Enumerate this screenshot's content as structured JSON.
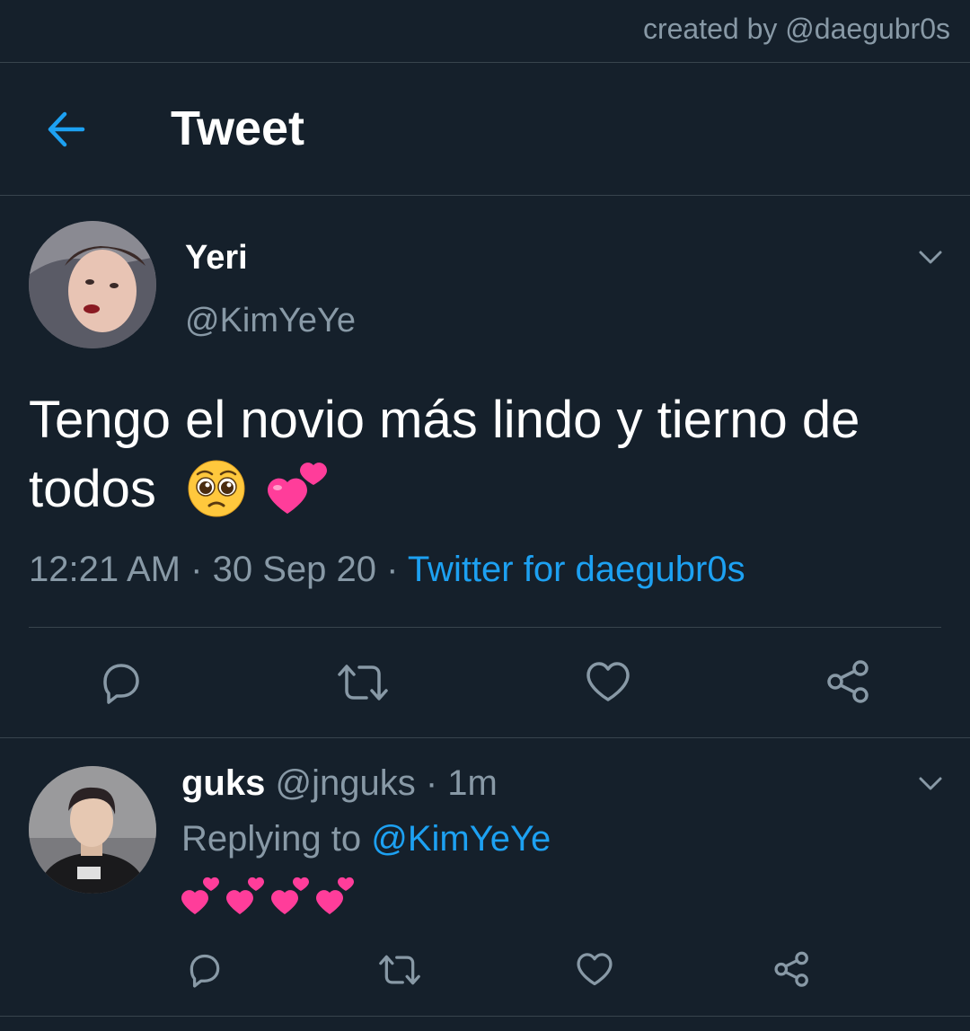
{
  "watermark": "created by @daegubr0s",
  "header": {
    "title": "Tweet",
    "back_icon": "arrow-left-icon"
  },
  "tweet": {
    "display_name": "Yeri",
    "handle": "@KimYeYe",
    "text": "Tengo el novio más lindo y tierno de todos",
    "emojis": [
      "pleading-face",
      "two-hearts"
    ],
    "time": "12:21 AM",
    "date": "30 Sep 20",
    "separator": "·",
    "source": "Twitter for daegubr0s",
    "actions": [
      "reply-icon",
      "retweet-icon",
      "like-icon",
      "share-icon"
    ]
  },
  "reply": {
    "display_name": "guks",
    "handle": "@jnguks",
    "separator": "·",
    "time": "1m",
    "replying_prefix": "Replying to",
    "replying_to": "@KimYeYe",
    "emojis": [
      "two-hearts",
      "two-hearts",
      "two-hearts",
      "two-hearts"
    ],
    "actions": [
      "reply-icon",
      "retweet-icon",
      "like-icon",
      "share-icon"
    ]
  },
  "colors": {
    "background": "#15202b",
    "divider": "#38444d",
    "secondary_text": "#8899a6",
    "accent": "#1da1f2",
    "heart_pink": "#ff3d9a",
    "emoji_face": "#ffc83d"
  }
}
